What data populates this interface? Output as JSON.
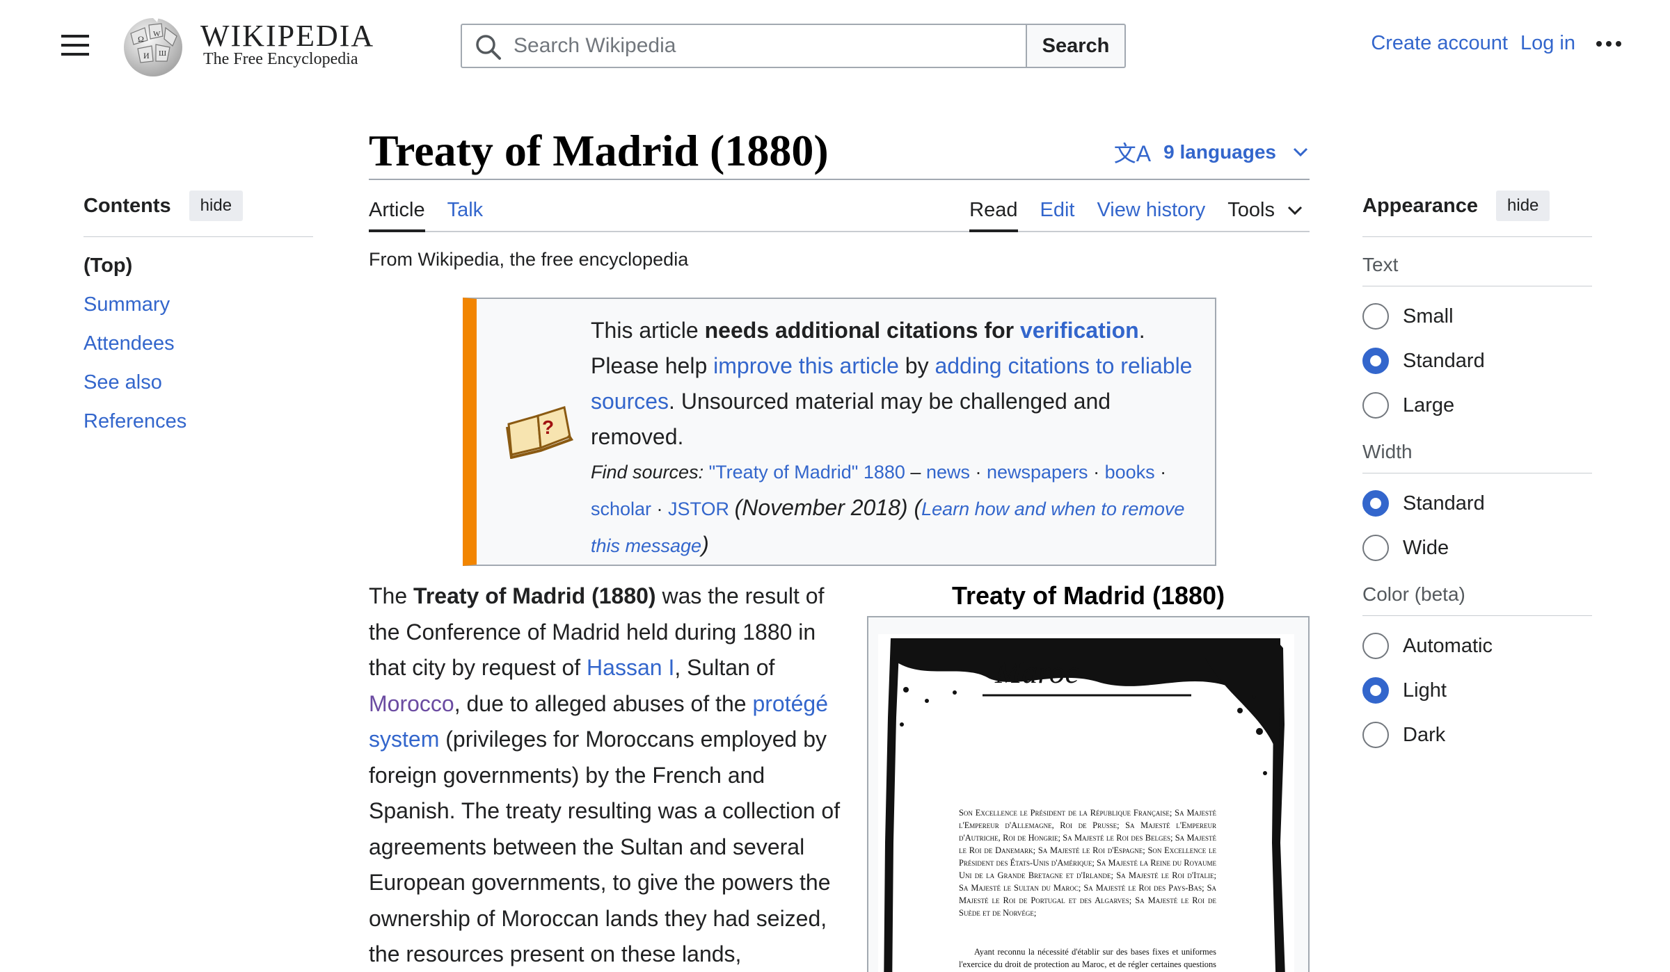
{
  "header": {
    "wordmark": "WIKIPEDIA",
    "tagline": "The Free Encyclopedia",
    "search_placeholder": "Search Wikipedia",
    "search_button": "Search",
    "create_account": "Create account",
    "log_in": "Log in"
  },
  "toc": {
    "title": "Contents",
    "hide": "hide",
    "items": [
      "(Top)",
      "Summary",
      "Attendees",
      "See also",
      "References"
    ]
  },
  "article": {
    "title": "Treaty of Madrid (1880)",
    "languages": "9 languages",
    "tabs": {
      "article": "Article",
      "talk": "Talk",
      "read": "Read",
      "edit": "Edit",
      "history": "View history",
      "tools": "Tools"
    },
    "from": "From Wikipedia, the free encyclopedia"
  },
  "ambox": {
    "t1": "This article ",
    "t2": "needs additional citations for ",
    "t3": "verification",
    "t4": ".",
    "t5": "Please help ",
    "t6": "improve this article",
    "t7": " by ",
    "t8": "adding citations to reliable sources",
    "t9": ". Unsourced material may be challenged and removed.",
    "find_sources": "Find sources:",
    "q": "\"Treaty of Madrid\" 1880",
    "dash": " – ",
    "news": "news",
    "newspapers": "newspapers",
    "books": "books",
    "scholar": "scholar",
    "jstor": "JSTOR",
    "sep": " · ",
    "date": "(November 2018)",
    "learn_open": " (",
    "learn": "Learn how and when to remove this message",
    "learn_close": ")"
  },
  "body": {
    "p1": "The ",
    "p2": "Treaty of Madrid (1880)",
    "p3": " was the result of the Conference of Madrid held during 1880 in that city by request of ",
    "p4": "Hassan I",
    "p5": ", Sultan of ",
    "p6": "Morocco",
    "p7": ", due to alleged abuses of the ",
    "p8": "protégé system",
    "p9": " (privileges for Moroccans employed by foreign governments) by the French and Spanish. The treaty resulting was a collection of agreements between the Sultan and several European governments, to give the powers the ownership of Moroccan lands they had seized, the resources present on these lands,"
  },
  "infobox": {
    "caption": "Treaty of Madrid (1880)",
    "doc_script": "Maroc",
    "doc_para1": "Son Excellence le Président de la République Française; Sa Majesté l'Empereur d'Allemagne, Roi de Prusse; Sa Majesté l'Empereur d'Autriche, Roi de Hongrie; Sa Majesté le Roi des Belges; Sa Majesté le Roi de Danemark; Sa Majesté le Roi d'Espagne; Son Excellence le Président des États-Unis d'Amérique; Sa Majesté la Reine du Royaume Uni de la Grande Bretagne et d'Irlande; Sa Majesté le Roi d'Italie; Sa Majesté le Sultan du Maroc; Sa Majesté le Roi des Pays-Bas; Sa Majesté le Roi de Portugal et des Algarves; Sa Majesté le Roi de Suède et de Norvége;",
    "doc_para2": "Ayant reconnu la nécessité d'établir sur des bases fixes et uniformes l'exercice du droit de protection au Maroc, et de régler certaines questions qui s'y rattachent, ont nommé pour leurs Plénipotentiaires à la Conférence qui s'est réunie à cet effet à"
  },
  "appearance": {
    "title": "Appearance",
    "hide": "hide",
    "text_label": "Text",
    "text_options": [
      "Small",
      "Standard",
      "Large"
    ],
    "text_selected": "Standard",
    "width_label": "Width",
    "width_options": [
      "Standard",
      "Wide"
    ],
    "width_selected": "Standard",
    "color_label": "Color (beta)",
    "color_options": [
      "Automatic",
      "Light",
      "Dark"
    ],
    "color_selected": "Light"
  },
  "colors": {
    "link": "#3366cc",
    "visited": "#6b4ba1",
    "ambox_border": "#f28500"
  }
}
